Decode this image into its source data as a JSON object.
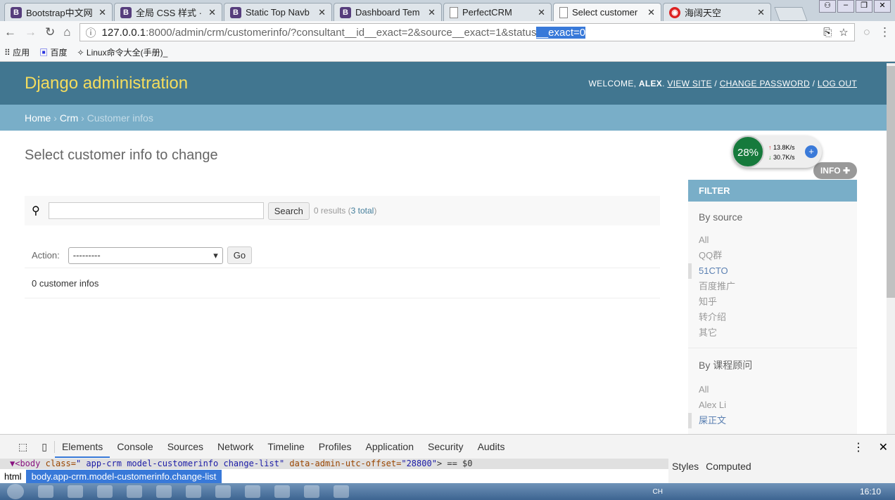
{
  "browser": {
    "tabs": [
      {
        "title": "Bootstrap中文网",
        "icon": "bootstrap-icon"
      },
      {
        "title": "全局 CSS 样式 · B",
        "icon": "bootstrap-icon"
      },
      {
        "title": "Static Top Navb",
        "icon": "bootstrap-icon"
      },
      {
        "title": "Dashboard Tem",
        "icon": "bootstrap-icon"
      },
      {
        "title": "PerfectCRM",
        "icon": "page-icon"
      },
      {
        "title": "Select customer",
        "icon": "page-icon",
        "active": true
      },
      {
        "title": "海阔天空",
        "icon": "netease-music-icon"
      }
    ],
    "url_host": "127.0.0.1",
    "url_rest": ":8000/admin/crm/customerinfo/?consultant__id__exact=2&source__exact=1&status",
    "url_selected": "__exact=0",
    "bookmarks": [
      "应用",
      "百度",
      "Linux命令大全(手册)_"
    ]
  },
  "header": {
    "title": "Django administration",
    "welcome": "WELCOME, ",
    "user": "ALEX",
    "view_site": "VIEW SITE",
    "change_password": "CHANGE PASSWORD",
    "log_out": "LOG OUT"
  },
  "breadcrumbs": {
    "home": "Home",
    "app": "Crm",
    "current": "Customer infos"
  },
  "main": {
    "title": "Select customer info to change",
    "add_label": "INFO",
    "search_button": "Search",
    "results": "0 results (",
    "total": "3 total",
    "results_end": ")",
    "action_label": "Action:",
    "action_value": "---------",
    "go": "Go",
    "count": "0 customer infos"
  },
  "widget": {
    "percent": "28%",
    "up": "13.8K/s",
    "down": "30.7K/s"
  },
  "filter": {
    "title": "FILTER",
    "groups": [
      {
        "title": "By source",
        "items": [
          "All",
          "QQ群",
          "51CTO",
          "百度推广",
          "知乎",
          "转介绍",
          "其它"
        ],
        "selected": 2
      },
      {
        "title": "By 课程顾问",
        "items": [
          "All",
          "Alex Li",
          "屎正文"
        ],
        "selected": 2
      }
    ]
  },
  "devtools": {
    "tabs": [
      "Elements",
      "Console",
      "Sources",
      "Network",
      "Timeline",
      "Profiles",
      "Application",
      "Security",
      "Audits"
    ],
    "active": "Elements",
    "dom_tag": "<body ",
    "dom_attr1": "class=",
    "dom_val1": "\" app-crm model-customerinfo change-list\"",
    "dom_attr2": " data-admin-utc-offset=",
    "dom_val2": "\"28800\"",
    "dom_end": "> == $0",
    "crumb_html": "html",
    "crumb_body": "body.app-crm.model-customerinfo.change-list",
    "styles": "Styles",
    "computed": "Computed"
  },
  "taskbar": {
    "clock": "16:10",
    "lang": "CH"
  }
}
